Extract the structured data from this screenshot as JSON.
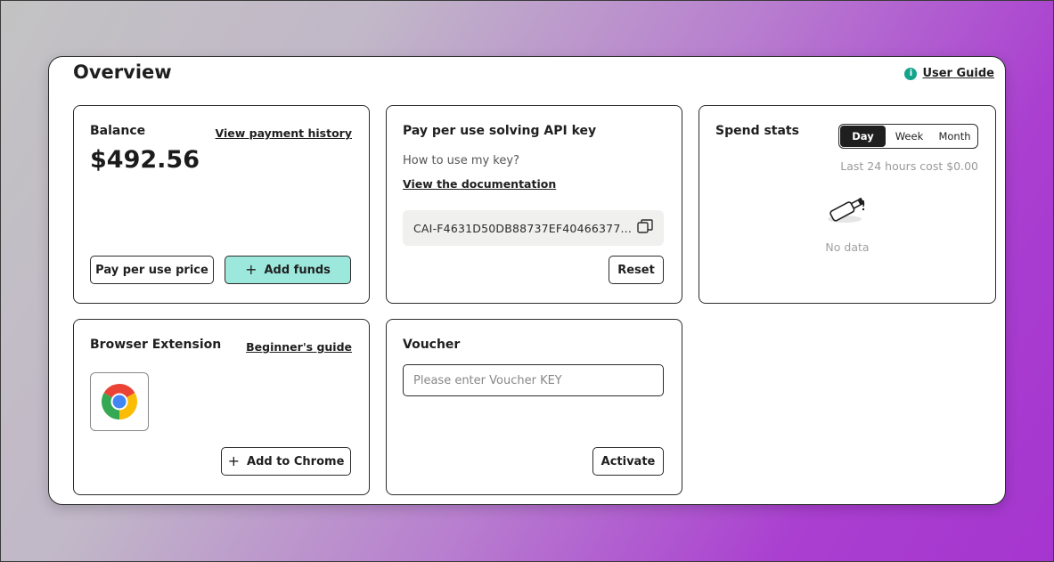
{
  "header": {
    "title": "Overview",
    "user_guide": "User Guide"
  },
  "balance": {
    "title": "Balance",
    "history_link": "View payment history",
    "amount": "$492.56",
    "price_button": "Pay per use price",
    "add_funds_button": "Add funds"
  },
  "api_key": {
    "title": "Pay per use solving API key",
    "how_to": "How to use my key?",
    "doc_link": "View the documentation",
    "key_value": "CAI-F4631D50DB88737EF40466377...",
    "reset_button": "Reset"
  },
  "spend": {
    "title": "Spend stats",
    "tabs": [
      "Day",
      "Week",
      "Month"
    ],
    "active_tab": "Day",
    "last_cost": "Last 24 hours cost $0.00",
    "no_data": "No data"
  },
  "extension": {
    "title": "Browser Extension",
    "guide_link": "Beginner's guide",
    "add_button": "Add to Chrome"
  },
  "voucher": {
    "title": "Voucher",
    "placeholder": "Please enter Voucher KEY",
    "value": "",
    "activate_button": "Activate"
  },
  "colors": {
    "accent": "#9de8dc",
    "guide_icon": "#14a38b",
    "dark": "#1f1f1f"
  }
}
